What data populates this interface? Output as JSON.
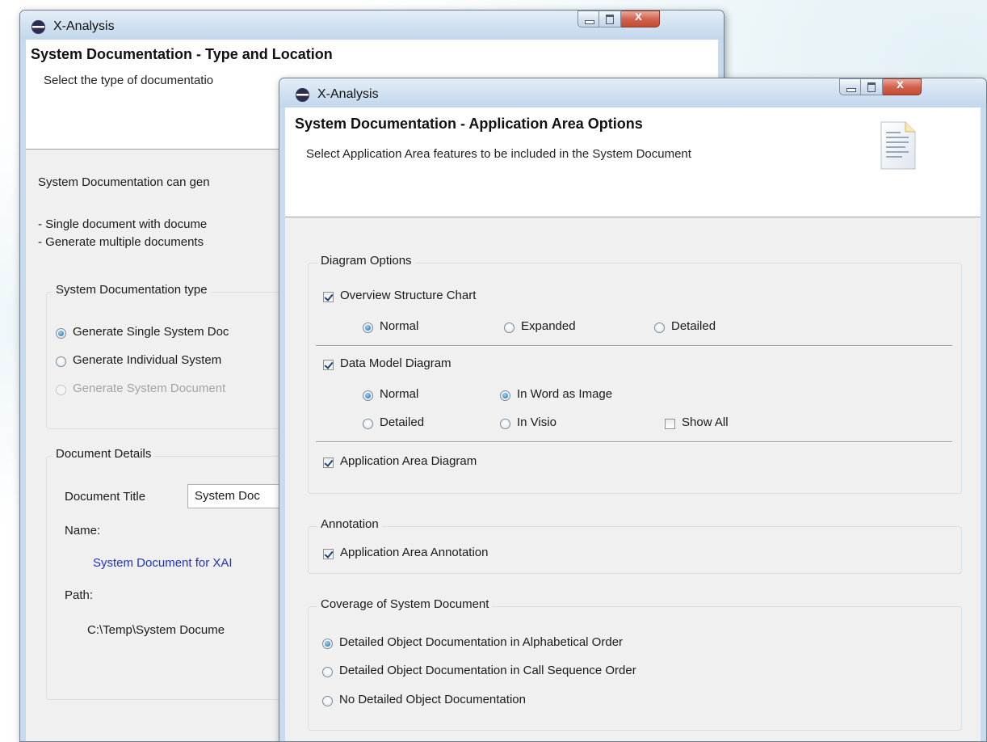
{
  "back_window": {
    "title": "X-Analysis",
    "banner_title": "System Documentation - Type and Location",
    "banner_subtitle": "Select the type of documentatio",
    "intro_text": "System Documentation can gen",
    "bullet_1": "- Single document with docume",
    "bullet_2": "- Generate multiple documents",
    "type_group": {
      "title": "System Documentation type",
      "options": [
        {
          "label": "Generate Single System Doc",
          "selected": true,
          "enabled": true
        },
        {
          "label": "Generate Individual System",
          "selected": false,
          "enabled": true
        },
        {
          "label": "Generate System Document",
          "selected": false,
          "enabled": false
        }
      ]
    },
    "details_group": {
      "title": "Document Details",
      "doc_title_label": "Document Title",
      "doc_title_value": "System Doc",
      "name_label": "Name:",
      "name_value": "System Document for XAI",
      "path_label": "Path:",
      "path_value": "C:\\Temp\\System Docume"
    }
  },
  "front_window": {
    "title": "X-Analysis",
    "banner_title": "System Documentation - Application Area Options",
    "banner_subtitle": "Select Application Area features to be included in the System Document",
    "diagram_group": {
      "title": "Diagram Options",
      "overview_chart": {
        "label": "Overview Structure Chart",
        "checked": true
      },
      "overview_radios": [
        {
          "label": "Normal",
          "selected": true
        },
        {
          "label": "Expanded",
          "selected": false
        },
        {
          "label": "Detailed",
          "selected": false
        }
      ],
      "data_model": {
        "label": "Data Model Diagram",
        "checked": true
      },
      "data_model_detail": [
        {
          "label": "Normal",
          "selected": true
        },
        {
          "label": "Detailed",
          "selected": false
        }
      ],
      "data_model_output": [
        {
          "label": "In Word as Image",
          "selected": true
        },
        {
          "label": "In Visio",
          "selected": false
        }
      ],
      "show_all": {
        "label": "Show All",
        "checked": false
      },
      "app_area_diagram": {
        "label": "Application Area Diagram",
        "checked": true
      }
    },
    "annotation_group": {
      "title": "Annotation",
      "app_area_annotation": {
        "label": "Application Area Annotation",
        "checked": true
      }
    },
    "coverage_group": {
      "title": "Coverage of System Document",
      "options": [
        {
          "label": "Detailed Object Documentation in Alphabetical Order",
          "selected": true
        },
        {
          "label": "Detailed Object Documentation in Call Sequence Order",
          "selected": false
        },
        {
          "label": "No Detailed Object Documentation",
          "selected": false
        }
      ]
    }
  },
  "colors": {
    "accent_radio": "#1f5f9e",
    "link": "#1d31c9",
    "titlebar": "#cfe0f1"
  }
}
